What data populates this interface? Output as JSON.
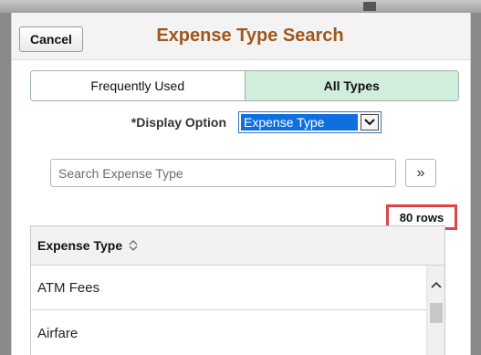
{
  "header": {
    "cancel_label": "Cancel",
    "title": "Expense Type Search"
  },
  "tabs": [
    {
      "label": "Frequently Used",
      "active": false
    },
    {
      "label": "All Types",
      "active": true
    }
  ],
  "display_option": {
    "label": "*Display Option",
    "selected": "Expense Type"
  },
  "search": {
    "placeholder": "Search Expense Type",
    "button_glyph": "»"
  },
  "results": {
    "count_text": "80 rows",
    "column_header": "Expense Type",
    "rows": [
      "ATM Fees",
      "Airfare"
    ]
  },
  "colors": {
    "title": "#a1561b",
    "active_tab": "#d1eddc",
    "highlight_box": "#e04545",
    "select_highlight": "#0e6fe0"
  },
  "icons": {
    "sort": "sort-updown-icon",
    "select_arrow": "chevron-down-icon",
    "search_button": "double-chevron-right-icon",
    "scroll_up": "scroll-up-arrow-icon"
  }
}
